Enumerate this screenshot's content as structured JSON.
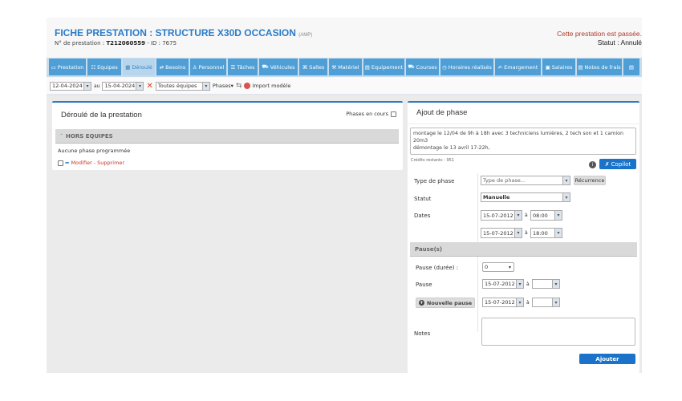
{
  "header": {
    "title": "FICHE PRESTATION : STRUCTURE X30D OCCASION",
    "title_tag": "(AMP)",
    "number_label": "N° de prestation :",
    "number": "T212060559",
    "id_label": "- ID : 7675",
    "passed": "Cette prestation est passée.",
    "status": "Statut : Annulé"
  },
  "tabs": [
    {
      "label": "Prestation",
      "icon": "folder-icon"
    },
    {
      "label": "Equipes",
      "icon": "team-icon"
    },
    {
      "label": "Déroulé",
      "icon": "calendar-icon",
      "active": true
    },
    {
      "label": "Besoins",
      "icon": "needs-icon"
    },
    {
      "label": "Personnel",
      "icon": "user-icon"
    },
    {
      "label": "Tâches",
      "icon": "list-icon"
    },
    {
      "label": "Véhicules",
      "icon": "truck-icon"
    },
    {
      "label": "Salles",
      "icon": "sitemap-icon"
    },
    {
      "label": "Matériel",
      "icon": "wrench-icon"
    },
    {
      "label": "Equipement",
      "icon": "equipment-icon"
    },
    {
      "label": "Courses",
      "icon": "truck-icon"
    },
    {
      "label": "Horaires réalisés",
      "icon": "clock-icon"
    },
    {
      "label": "Emargement",
      "icon": "signature-icon"
    },
    {
      "label": "Salaires",
      "icon": "money-icon"
    },
    {
      "label": "Notes de frais",
      "icon": "receipt-icon"
    },
    {
      "label": "",
      "icon": "more-icon"
    }
  ],
  "toolbar": {
    "date_from": "12-04-2024",
    "au": "au",
    "date_to": "15-04-2024",
    "team_filter": "Toutes équipes",
    "phases": "Phases",
    "import": "Import modèle"
  },
  "left": {
    "title": "Déroulé de la prestation",
    "phases_en_cours": "Phases en cours",
    "group": "HORS EQUIPES",
    "empty": "Aucune phase programmée",
    "modify": "Modifier",
    "sep": "-",
    "delete": "Supprimer"
  },
  "right": {
    "title": "Ajout de phase",
    "prompt": "montage le 12/04 de 9h à 18h avec 3 techniciens lumières, 2 tech son et 1 camion 20m3\ndémontage le 13 avril 17-22h,",
    "credits": "Crédits restants : 951",
    "copilot": "Copilot",
    "type_label": "Type de phase",
    "type_placeholder": "Type de phase...",
    "recurrence": "Récurrence",
    "statut_label": "Statut",
    "statut_value": "Manuelle",
    "dates_label": "Dates",
    "start_date": "15-07-2012",
    "start_time": "08:00",
    "end_date": "15-07-2012",
    "end_time": "18:00",
    "a": "à",
    "pauses_header": "Pause(s)",
    "pause_duration_label": "Pause (durée) :",
    "pause_duration": "0",
    "pause_label": "Pause",
    "pause_date1": "15-07-2012",
    "pause_date2": "15-07-2012",
    "new_pause": "Nouvelle pause",
    "notes_label": "Notes",
    "submit": "Ajouter"
  }
}
